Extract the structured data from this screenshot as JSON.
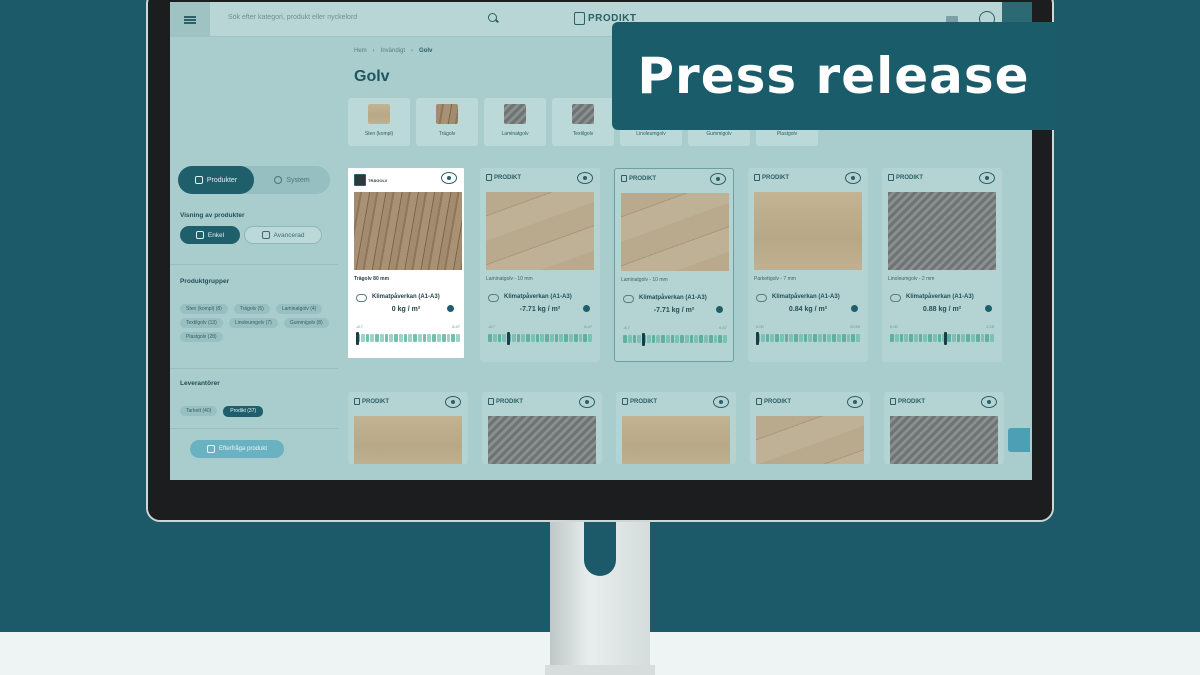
{
  "banner": {
    "text": "Press release"
  },
  "app": {
    "search_placeholder": "Sök efter kategori, produkt eller nyckelord",
    "logo": "PRODIKT"
  },
  "breadcrumb": [
    "Hem",
    "Invändigt",
    "Golv"
  ],
  "page_title": "Golv",
  "categories": [
    "Sten (kompl)",
    "Trägolv",
    "Laminatgolv",
    "Textilgolv",
    "Linoleumgolv",
    "Gummigolv",
    "Plastgolv"
  ],
  "sidebar": {
    "toggle": {
      "products": "Produkter",
      "system": "System"
    },
    "view_heading": "Visning av produkter",
    "view_simple": "Enkel",
    "view_advanced": "Avancerad",
    "groups_heading": "Produktgrupper",
    "groups": [
      "Sten (kompl) (8)",
      "Trägolv (5)",
      "Laminatgolv (4)",
      "Textilgolv (13)",
      "Linoleumgolv (7)",
      "Gummigolv (8)",
      "Plastgolv (28)"
    ],
    "suppliers_heading": "Leverantörer",
    "suppliers": [
      "Tarkett (40)",
      "Prodikt (37)"
    ],
    "suggest_button": "Efterfråga produkt"
  },
  "cards": [
    {
      "brand": "",
      "name": "Trägolv 80 mm",
      "label": "Klimatpåverkan (A1-A3)",
      "value": "0 kg / m²",
      "range_min": "-8.7",
      "range_max": "6.47",
      "marker": 0.0
    },
    {
      "brand": "PRODIKT",
      "name": "Laminatgolv - 10 mm",
      "label": "Klimatpåverkan (A1-A3)",
      "value": "-7.71 kg / m²",
      "range_min": "-8.7",
      "range_max": "6.47",
      "marker": 0.18
    },
    {
      "brand": "PRODIKT",
      "name": "Laminatgolv - 10 mm",
      "label": "Klimatpåverkan (A1-A3)",
      "value": "-7.71 kg / m²",
      "range_min": "-8.7",
      "range_max": "6.47",
      "marker": 0.18
    },
    {
      "brand": "PRODIKT",
      "name": "Parkettgolv - 7 mm",
      "label": "Klimatpåverkan (A1-A3)",
      "value": "0.84 kg / m²",
      "range_min": "0.00",
      "range_max": "20.59",
      "marker": 0.0
    },
    {
      "brand": "PRODIKT",
      "name": "Linoleumgolv - 2 mm",
      "label": "Klimatpåverkan (A1-A3)",
      "value": "0.88 kg / m²",
      "range_min": "0.00",
      "range_max": "2.25",
      "marker": 0.52
    }
  ],
  "cards_row2": [
    "PRODIKT",
    "PRODIKT",
    "PRODIKT",
    "PRODIKT",
    "PRODIKT"
  ]
}
